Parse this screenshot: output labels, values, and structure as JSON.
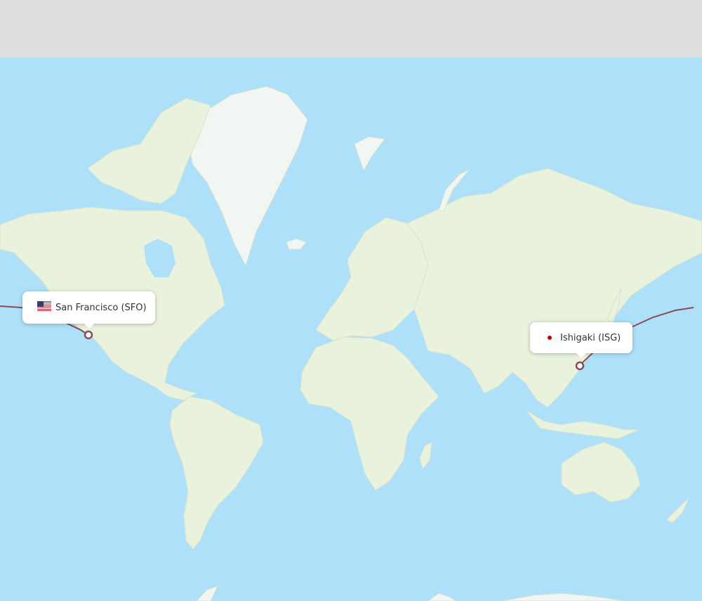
{
  "origin": {
    "city_label": "San Francisco (SFO)",
    "marker_icon": "us-flag-icon"
  },
  "destination": {
    "city_label": "Ishigaki (ISG)",
    "marker_icon": "red-dot-icon"
  },
  "colors": {
    "ocean": "#aee0f9",
    "land": "#e8f2dc",
    "ice": "#f2f6f2",
    "route": "#8b4a55",
    "top_bar": "#dedede"
  }
}
